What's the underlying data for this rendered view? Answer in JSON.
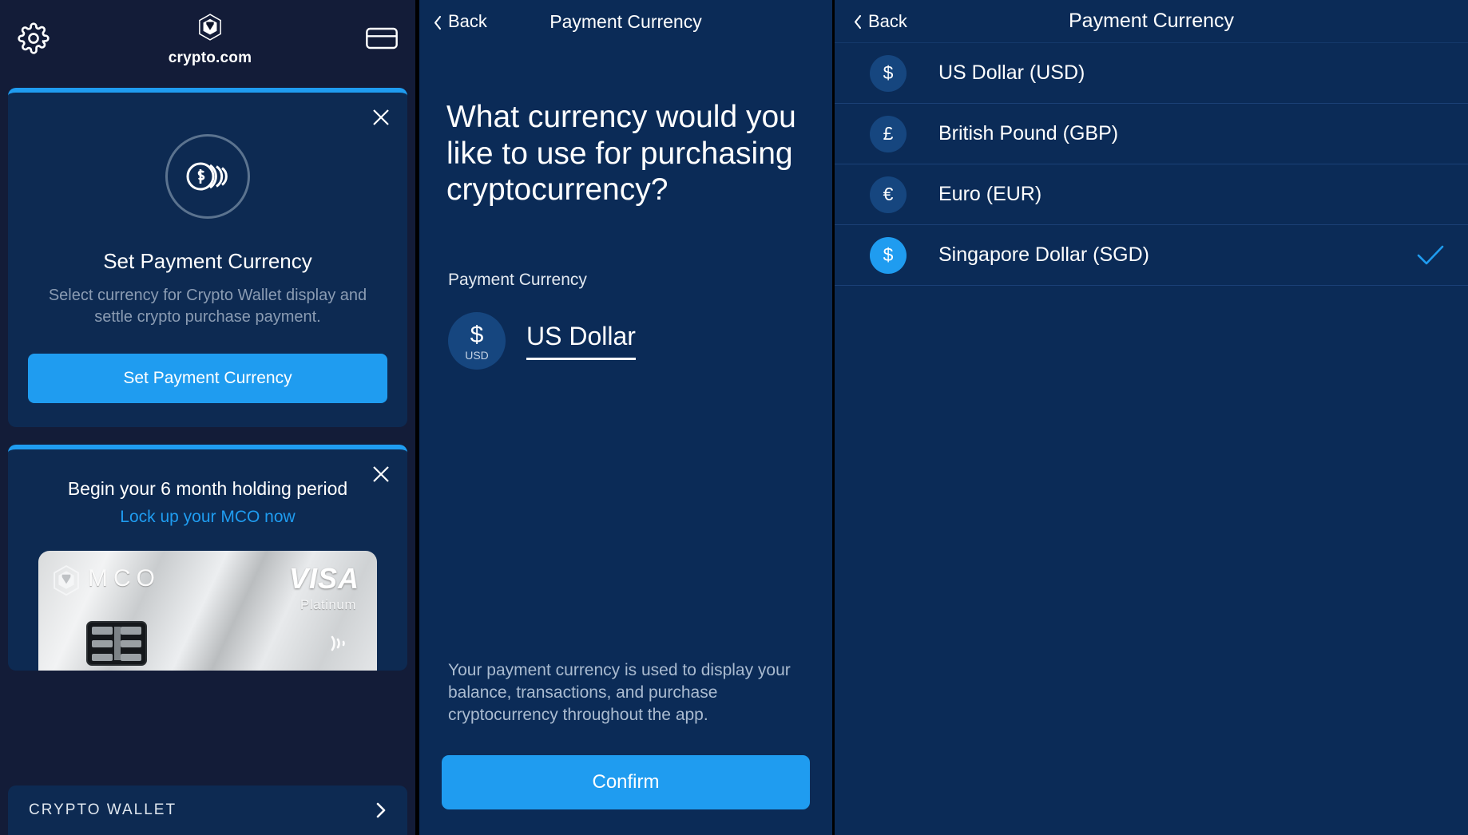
{
  "colors": {
    "accent": "#1f9cf0",
    "panel_bg": "#0b2b57",
    "card_bg": "#0d2a52",
    "left_bg": "#131c38",
    "muted_text": "#8b9cb3",
    "badge_bg": "#16467f"
  },
  "left_panel": {
    "topbar": {
      "settings_icon": "gear-icon",
      "wallet_icon": "credit-card-icon",
      "brand_logo_icon": "crypto-com-hex-logo-icon",
      "brand_name": "crypto.com"
    },
    "promo_card": {
      "close_icon": "close-icon",
      "hero_icon": "coins-stack-icon",
      "title": "Set Payment Currency",
      "description": "Select currency for Crypto Wallet display and settle crypto purchase payment.",
      "button_label": "Set Payment Currency"
    },
    "mco_card": {
      "close_icon": "close-icon",
      "title": "Begin your 6 month holding period",
      "link_label": "Lock up your MCO now",
      "card_art": {
        "logo_icon": "crypto-com-hex-logo-icon",
        "brand_text": "MCO",
        "network_text": "VISA",
        "tier_text": "Platinum",
        "contactless_icon": "contactless-icon",
        "chip_icon": "emv-chip-icon"
      }
    },
    "wallet_row": {
      "label": "CRYPTO WALLET",
      "chevron_icon": "chevron-right-icon"
    }
  },
  "middle_panel": {
    "nav": {
      "back_icon": "chevron-left-icon",
      "back_label": "Back",
      "title": "Payment Currency"
    },
    "question": "What currency would you like to use for purchasing cryptocurrency?",
    "section_label": "Payment Currency",
    "selected_currency": {
      "symbol": "$",
      "code": "USD",
      "name": "US Dollar"
    },
    "note": "Your payment currency is used to display your balance, transactions, and purchase cryptocurrency throughout the app.",
    "confirm_label": "Confirm"
  },
  "right_panel": {
    "nav": {
      "back_icon": "chevron-left-icon",
      "back_label": "Back",
      "title": "Payment Currency"
    },
    "currencies": [
      {
        "symbol": "$",
        "label": "US Dollar (USD)",
        "selected": false
      },
      {
        "symbol": "£",
        "label": "British Pound (GBP)",
        "selected": false
      },
      {
        "symbol": "€",
        "label": "Euro (EUR)",
        "selected": false
      },
      {
        "symbol": "$",
        "label": "Singapore Dollar (SGD)",
        "selected": true
      }
    ],
    "check_icon": "check-icon"
  }
}
